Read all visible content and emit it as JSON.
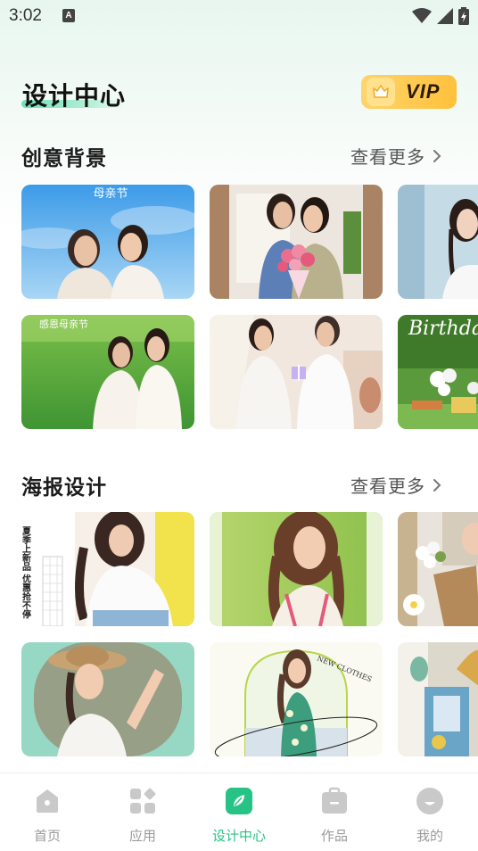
{
  "status_bar": {
    "time": "3:02",
    "notification_badge": "A"
  },
  "header": {
    "title": "设计中心",
    "vip_label": "VIP"
  },
  "sections": [
    {
      "title": "创意背景",
      "see_more": "查看更多"
    },
    {
      "title": "海报设计",
      "see_more": "查看更多"
    }
  ],
  "cards": {
    "mothers_day_1": {
      "text": "母亲节"
    },
    "mothers_day_2": {
      "text": "感恩母亲节"
    },
    "birthday": {
      "text": "Birthda"
    },
    "summer_poster": {
      "text": "夏季上新品 优惠抢不停"
    },
    "new_clothes": {
      "text": "NEW CLOTHES"
    }
  },
  "bottom_nav": [
    {
      "label": "首页",
      "icon": "home-icon",
      "active": false
    },
    {
      "label": "应用",
      "icon": "apps-icon",
      "active": false
    },
    {
      "label": "设计中心",
      "icon": "design-icon",
      "active": true
    },
    {
      "label": "作品",
      "icon": "works-icon",
      "active": false
    },
    {
      "label": "我的",
      "icon": "profile-icon",
      "active": false
    }
  ],
  "colors": {
    "accent": "#27c285",
    "vip": "#ffc13c",
    "nav_inactive": "#c6c6c6"
  }
}
